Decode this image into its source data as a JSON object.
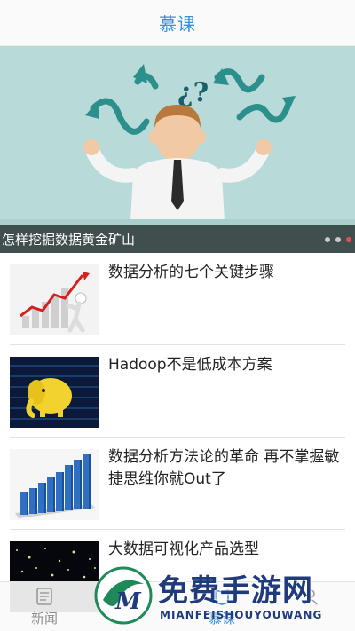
{
  "header": {
    "title": "慕课"
  },
  "banner": {
    "caption": "怎样挖掘数据黄金矿山",
    "page_count": 3,
    "active_page": 3,
    "question_marks": "¿?"
  },
  "articles": [
    {
      "title": "数据分析的七个关键步骤",
      "thumb_icon": "rising-chart-figure"
    },
    {
      "title": "Hadoop不是低成本方案",
      "thumb_icon": "hadoop-elephant"
    },
    {
      "title": "数据分析方法论的革命 再不掌握敏捷思维你就Out了",
      "thumb_icon": "bar-chart-3d"
    },
    {
      "title": "大数据可视化产品选型",
      "thumb_icon": "starfield"
    }
  ],
  "tabs": [
    {
      "label": "新闻",
      "icon": "document-icon",
      "active": false
    },
    {
      "label": "",
      "icon": "compass-icon",
      "active": false
    },
    {
      "label": "慕课",
      "icon": "book-icon",
      "active": true
    },
    {
      "label": "",
      "icon": "user-icon",
      "active": false
    }
  ],
  "watermark": {
    "title": "免费手游网",
    "subtitle": "MIANFEISHOUYOUWANG",
    "logo_letter": "M"
  },
  "colors": {
    "accent": "#3a8fd6",
    "banner_bg": "#b8dbd9",
    "dot_active": "#e05050",
    "watermark": "#1f3b7d"
  }
}
